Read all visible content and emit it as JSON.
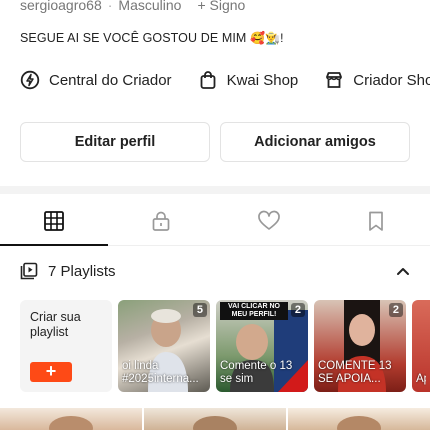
{
  "profile": {
    "username": "sergioagro68",
    "gender": "Masculino",
    "sign_label": "+ Signo",
    "bio": "SEGUE AI SE VOCÊ GOSTOU DE MIM",
    "bio_emoji": "🥰👨‍🌾!"
  },
  "links": [
    {
      "label": "Central do Criador",
      "icon": "lightning-circle-icon"
    },
    {
      "label": "Kwai Shop",
      "icon": "shopping-bag-icon"
    },
    {
      "label": "Criador Sho",
      "icon": "store-icon"
    }
  ],
  "actions": {
    "edit_profile": "Editar perfil",
    "add_friends": "Adicionar amigos"
  },
  "tabs": [
    {
      "name": "grid",
      "icon": "grid-icon",
      "active": true
    },
    {
      "name": "private",
      "icon": "lock-icon",
      "active": false
    },
    {
      "name": "liked",
      "icon": "heart-icon",
      "active": false
    },
    {
      "name": "saved",
      "icon": "bookmark-icon",
      "active": false
    }
  ],
  "playlists": {
    "header": "7 Playlists",
    "create_label": "Criar sua playlist",
    "create_button": "+",
    "items": [
      {
        "count": "5",
        "title": "oi linda #2025interna..."
      },
      {
        "count": "2",
        "title": "Comente o 13 se sim",
        "tag": "VAI CLICAR NO MEU PERFIL!"
      },
      {
        "count": "2",
        "title": "COMENTE 13 SE APOIA..."
      },
      {
        "count": "",
        "title": "Ap"
      }
    ]
  },
  "colors": {
    "accent": "#fe4a16",
    "text": "#222222",
    "muted": "#777777"
  }
}
